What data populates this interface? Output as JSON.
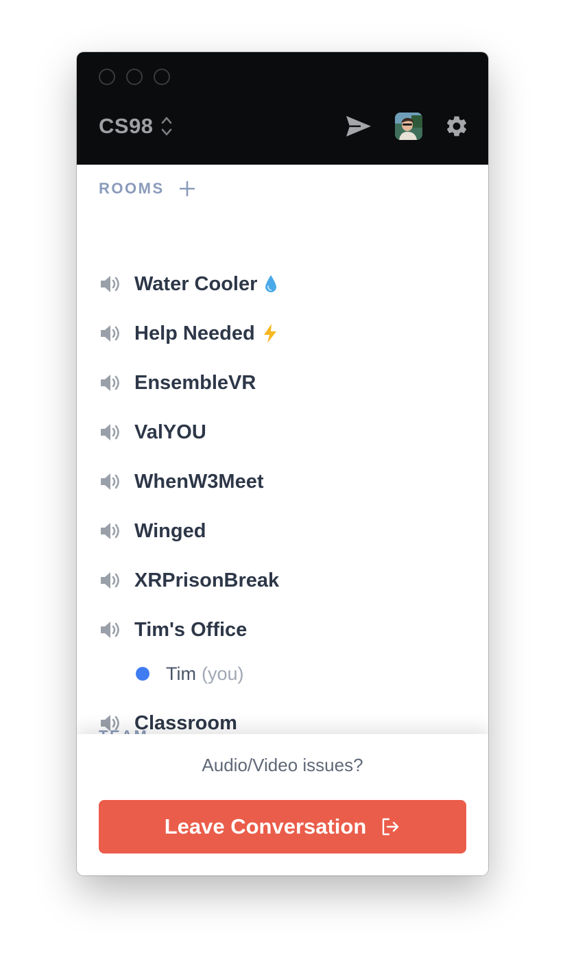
{
  "header": {
    "team_name": "CS98"
  },
  "rooms": {
    "section_label": "ROOMS",
    "items": [
      {
        "label": "Water Cooler",
        "emoji": "droplet-icon"
      },
      {
        "label": "Help Needed",
        "emoji": "lightning-icon"
      },
      {
        "label": "EnsembleVR"
      },
      {
        "label": "ValYOU"
      },
      {
        "label": "WhenW3Meet"
      },
      {
        "label": "Winged"
      },
      {
        "label": "XRPrisonBreak"
      },
      {
        "label": "Tim's Office"
      },
      {
        "label": "Classroom"
      }
    ],
    "occupants": [
      {
        "room": "Tim's Office",
        "name": "Tim",
        "suffix": "(you)",
        "status_color": "#3f7cf2"
      }
    ]
  },
  "team_section": {
    "label": "TEAM"
  },
  "help": {
    "label": "?"
  },
  "footer": {
    "issues_link": "Audio/Video issues?",
    "leave_label": "Leave Conversation"
  },
  "colors": {
    "header_bg": "#0b0c0e",
    "leave_button": "#ea5d4a",
    "help_button": "#4580f6",
    "room_text": "#2d3748",
    "section_label": "#8a9bbb"
  }
}
